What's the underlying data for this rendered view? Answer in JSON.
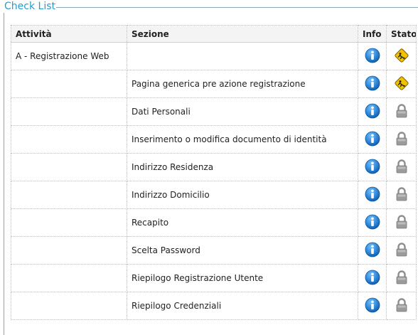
{
  "panel": {
    "legend": "Check List"
  },
  "table": {
    "headers": {
      "attivita": "Attività",
      "sezione": "Sezione",
      "info": "Info",
      "stato": "Stato"
    },
    "rows": [
      {
        "attivita": "A - Registrazione Web",
        "sezione": "",
        "stato": "in-progress-icon"
      },
      {
        "attivita": "",
        "sezione": "Pagina generica pre azione registrazione",
        "stato": "in-progress-icon"
      },
      {
        "attivita": "",
        "sezione": "Dati Personali",
        "stato": "lock-icon"
      },
      {
        "attivita": "",
        "sezione": "Inserimento o modifica documento di identità",
        "stato": "lock-icon"
      },
      {
        "attivita": "",
        "sezione": "Indirizzo Residenza",
        "stato": "lock-icon"
      },
      {
        "attivita": "",
        "sezione": "Indirizzo Domicilio",
        "stato": "lock-icon"
      },
      {
        "attivita": "",
        "sezione": "Recapito",
        "stato": "lock-icon"
      },
      {
        "attivita": "",
        "sezione": "Scelta Password",
        "stato": "lock-icon"
      },
      {
        "attivita": "",
        "sezione": "Riepilogo Registrazione Utente",
        "stato": "lock-icon"
      },
      {
        "attivita": "",
        "sezione": "Riepilogo Credenziali",
        "stato": "lock-icon"
      }
    ]
  },
  "colors": {
    "legend": "#2a9cc9",
    "border": "#8aa4b8",
    "info": "#1a7fd4",
    "sign": "#f2c200",
    "lock": "#8f8f8f"
  }
}
